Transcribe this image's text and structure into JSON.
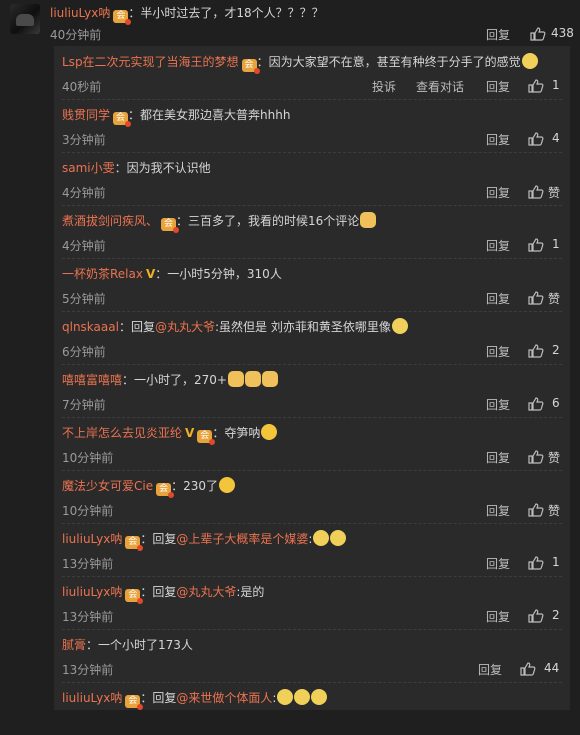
{
  "main": {
    "user": "liuliuLyx呐",
    "text": "：半小时过去了，才18个人？？？？",
    "time": "40分钟前",
    "reply_label": "回复",
    "likes": "438"
  },
  "replies": [
    {
      "user": "Lsp在二次元实现了当海王的梦想",
      "text": "：因为大家望不在意，甚至有种终于分手了的感觉",
      "time": "40秒前",
      "extra": [
        "投诉",
        "查看对话"
      ],
      "reply_label": "回复",
      "likes": "1",
      "badge": "vip",
      "emoji": [
        "cry"
      ]
    },
    {
      "user": "贱贯同学",
      "text": "：都在美女那边喜大普奔hhhh",
      "time": "3分钟前",
      "reply_label": "回复",
      "likes": "4",
      "badge": "vip"
    },
    {
      "user": "sami小雯",
      "text": "：因为我不认识他",
      "time": "4分钟前",
      "reply_label": "回复",
      "likes": "赞"
    },
    {
      "user": "煮酒拔剑问疾风、",
      "text": "：三百多了，我看的时候16个评论",
      "time": "4分钟前",
      "reply_label": "回复",
      "likes": "1",
      "badge": "vip",
      "emoji": [
        "dog"
      ]
    },
    {
      "user": "一杯奶茶Relax",
      "text": "：一小时5分钟，310人",
      "time": "5分钟前",
      "reply_label": "回复",
      "likes": "赞",
      "vbadge": "V"
    },
    {
      "user": "qlnskaaal",
      "text": "：回复",
      "mention": "@丸丸大爷",
      "text2": ":虽然但是 刘亦菲和黄圣依哪里像",
      "time": "6分钟前",
      "reply_label": "回复",
      "likes": "2",
      "emoji": [
        "cry"
      ]
    },
    {
      "user": "嘻嘻富嘻嘻",
      "text": "：一小时了，270+",
      "time": "7分钟前",
      "reply_label": "回复",
      "likes": "6",
      "emoji": [
        "dog",
        "dog",
        "dog"
      ]
    },
    {
      "user": "不上岸怎么去见炎亚纶",
      "text": "：夺笋呐",
      "time": "10分钟前",
      "reply_label": "回复",
      "likes": "赞",
      "vbadge": "V",
      "badge": "vip",
      "emoji": [
        "laugh"
      ]
    },
    {
      "user": "魔法少女可爱Cie",
      "text": "：230了",
      "time": "10分钟前",
      "reply_label": "回复",
      "likes": "赞",
      "badge": "vip",
      "emoji": [
        "laugh"
      ]
    },
    {
      "user": "liuliuLyx呐",
      "text": "：回复",
      "mention": "@上辈子大概率是个媒婆",
      "text2": ":",
      "time": "13分钟前",
      "reply_label": "回复",
      "likes": "1",
      "badge": "vip",
      "emoji": [
        "cry",
        "cry"
      ]
    },
    {
      "user": "liuliuLyx呐",
      "text": "：回复",
      "mention": "@丸丸大爷",
      "text2": ":是的",
      "time": "13分钟前",
      "reply_label": "回复",
      "likes": "2",
      "badge": "vip"
    },
    {
      "user": "腻膏",
      "text": "：一个小时了173人",
      "time": "13分钟前",
      "reply_label": "回复",
      "likes": "44"
    },
    {
      "user": "liuliuLyx呐",
      "text": "：回复",
      "mention": "@来世做个体面人",
      "text2": ":",
      "time": "",
      "reply_label": "",
      "likes": "",
      "badge": "vip",
      "emoji": [
        "cry",
        "cry",
        "cry"
      ]
    }
  ],
  "icons": {
    "thumb": "thumbs-up-icon",
    "badge": "member-badge-icon",
    "vbadge": "verified-v-icon",
    "emoji": "emoji-icon"
  },
  "colors": {
    "username": "#eb7350",
    "background": "#1f1f1f",
    "reply_panel": "#2a2a2a",
    "badge": "#e8a33d"
  }
}
